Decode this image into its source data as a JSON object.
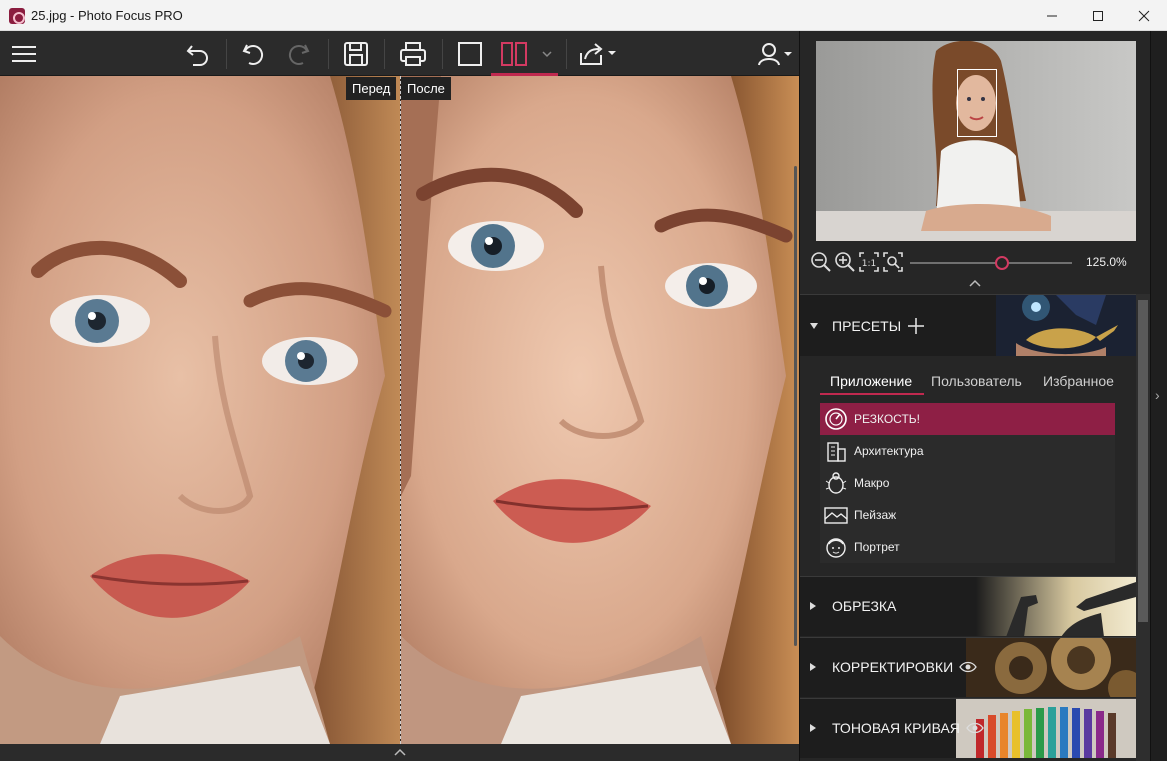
{
  "window": {
    "title": "25.jpg - Photo Focus PRO"
  },
  "compare": {
    "before_label": "Перед",
    "after_label": "После"
  },
  "zoom": {
    "value_text": "125.0%",
    "level": 0.57
  },
  "presets": {
    "header": "ПРЕСЕТЫ",
    "tabs": [
      "Приложение",
      "Пользователь",
      "Избранное"
    ],
    "items": [
      "РЕЗКОСТЬ!",
      "Архитектура",
      "Макро",
      "Пейзаж",
      "Портрет"
    ]
  },
  "sections": {
    "crop": "ОБРЕЗКА",
    "adjust": "КОРРЕКТИРОВКИ",
    "curve": "ТОНОВАЯ КРИВАЯ"
  },
  "colors": {
    "accent": "#c0294f",
    "selected": "#8e1f45"
  }
}
